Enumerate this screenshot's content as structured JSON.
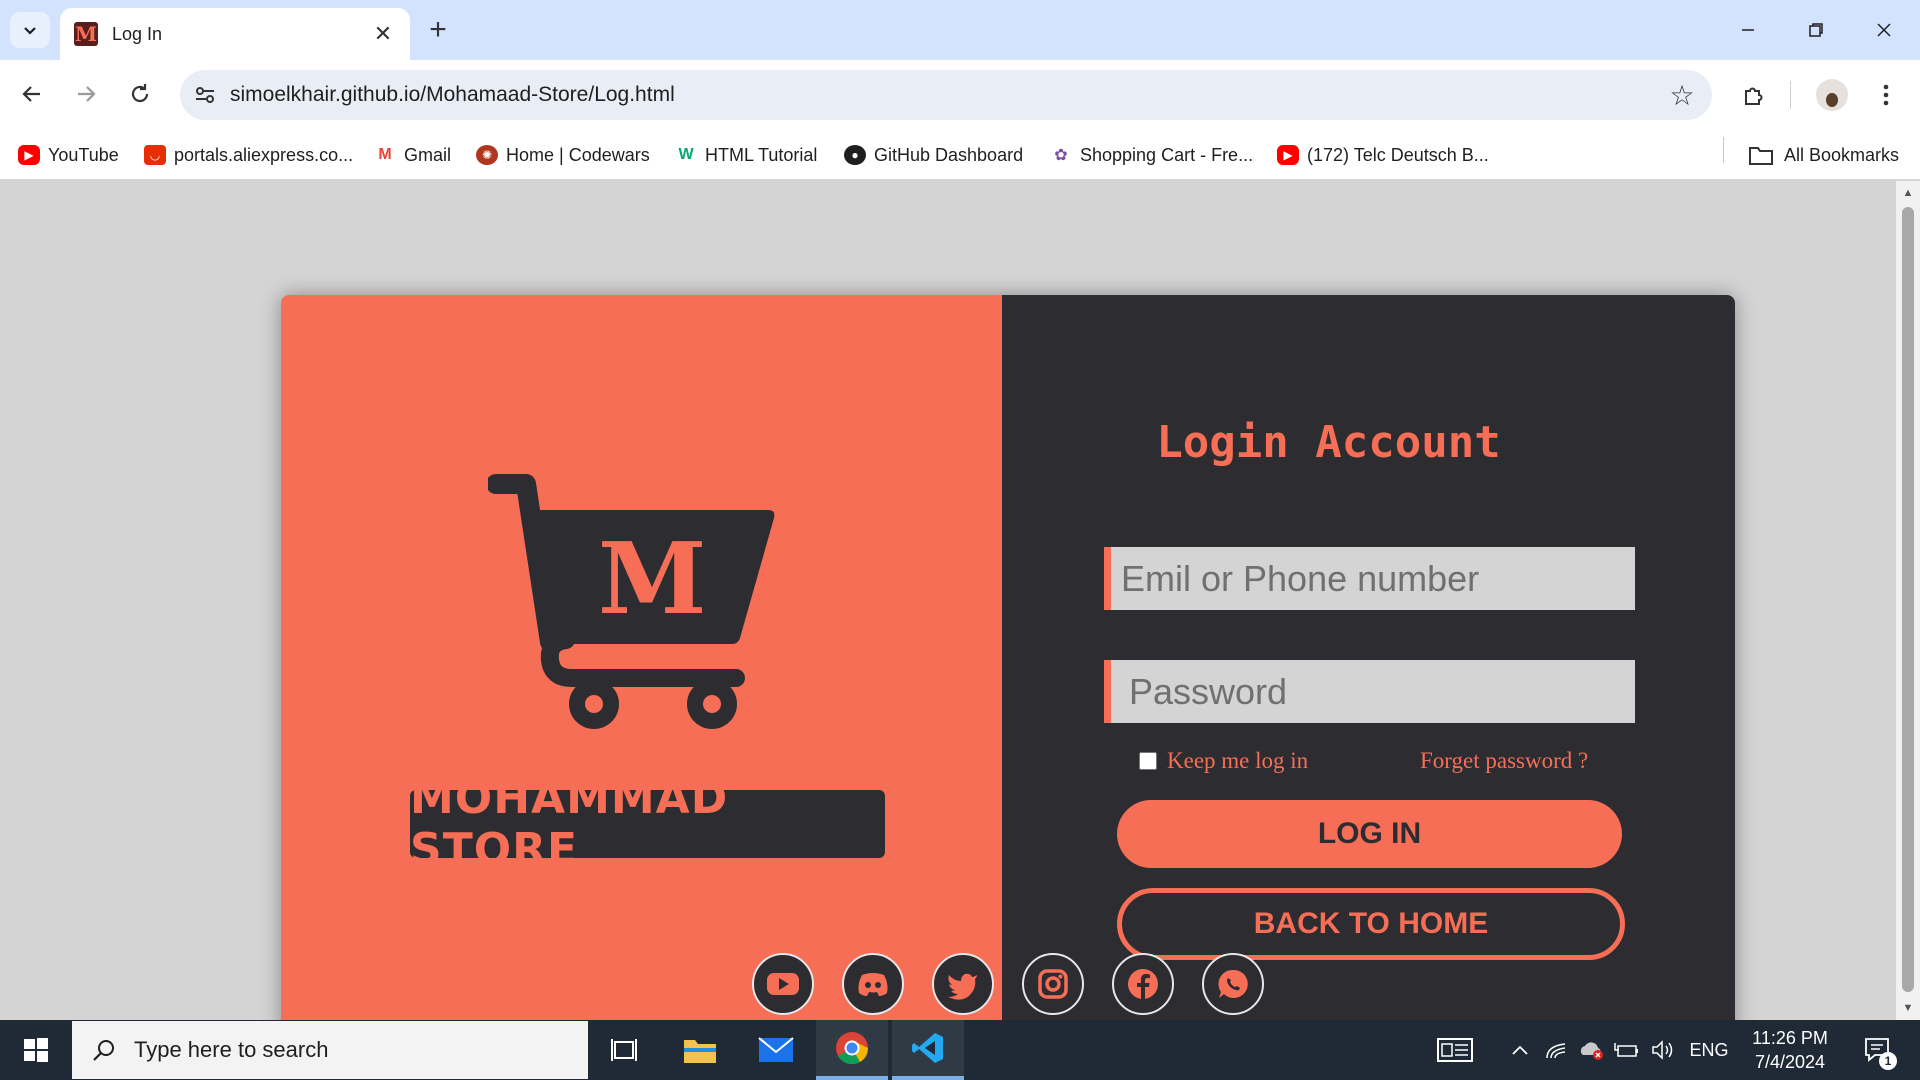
{
  "browser": {
    "tab_title": "Log In",
    "tab_favicon_letter": "M",
    "url": "simoelkhair.github.io/Mohamaad-Store/Log.html",
    "bookmarks": [
      {
        "label": "YouTube",
        "icon": "youtube-icon",
        "color": "#ff0000"
      },
      {
        "label": "portals.aliexpress.co...",
        "icon": "aliexpress-icon",
        "color": "#e62e04"
      },
      {
        "label": "Gmail",
        "icon": "gmail-icon",
        "color": "#ea4335"
      },
      {
        "label": "Home | Codewars",
        "icon": "codewars-icon",
        "color": "#b1361e"
      },
      {
        "label": "HTML Tutorial",
        "icon": "w3schools-icon",
        "color": "#04aa6d"
      },
      {
        "label": "GitHub Dashboard",
        "icon": "github-icon",
        "color": "#1f1f1f"
      },
      {
        "label": "Shopping Cart - Fre...",
        "icon": "shopping-cart-icon",
        "color": "#7b4fa0"
      },
      {
        "label": "(172) Telc Deutsch B...",
        "icon": "youtube-icon",
        "color": "#ff0000"
      }
    ],
    "all_bookmarks_label": "All Bookmarks"
  },
  "page": {
    "brand_name": "MOHAMMAD STORE",
    "cart_logo_letter": "M",
    "login_title": "Login Account",
    "email_placeholder": "Emil or Phone number",
    "password_placeholder": "Password",
    "keep_logged_in_label": "Keep me log in",
    "forgot_password_label": "Forget password ?",
    "login_button": "LOG IN",
    "back_home_button": "BACK TO HOME",
    "social_icons": [
      "youtube-icon",
      "discord-icon",
      "twitter-icon",
      "instagram-icon",
      "facebook-icon",
      "whatsapp-icon"
    ],
    "colors": {
      "accent": "#f76e56",
      "dark": "#2d2c31",
      "field_bg": "#d4d4d4"
    }
  },
  "taskbar": {
    "search_placeholder": "Type here to search",
    "language": "ENG",
    "time": "11:26 PM",
    "date": "7/4/2024",
    "notification_count": "1"
  }
}
